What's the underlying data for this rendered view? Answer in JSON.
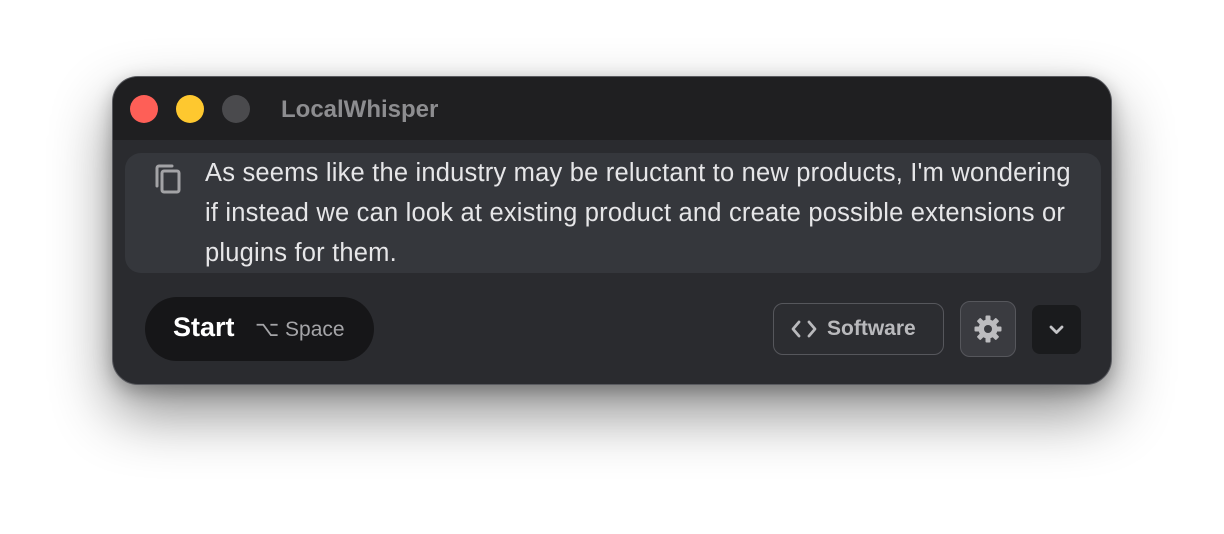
{
  "window": {
    "title": "LocalWhisper"
  },
  "transcript": {
    "text": "As seems like the industry may be reluctant to new products, I'm wondering if instead we can look at existing product and create possible extensions or plugins for them.",
    "copy_icon": "copy-icon"
  },
  "controls": {
    "start_label": "Start",
    "shortcut": "⌥ Space",
    "mode_label": "Software",
    "mode_icon": "code-icon",
    "settings_icon": "gear-icon",
    "dropdown_icon": "chevron-down-icon"
  },
  "colors": {
    "close": "#fe5f57",
    "minimize": "#fec82f",
    "zoom_disabled": "#4a4a4d",
    "window_bg": "#2a2b2f"
  }
}
